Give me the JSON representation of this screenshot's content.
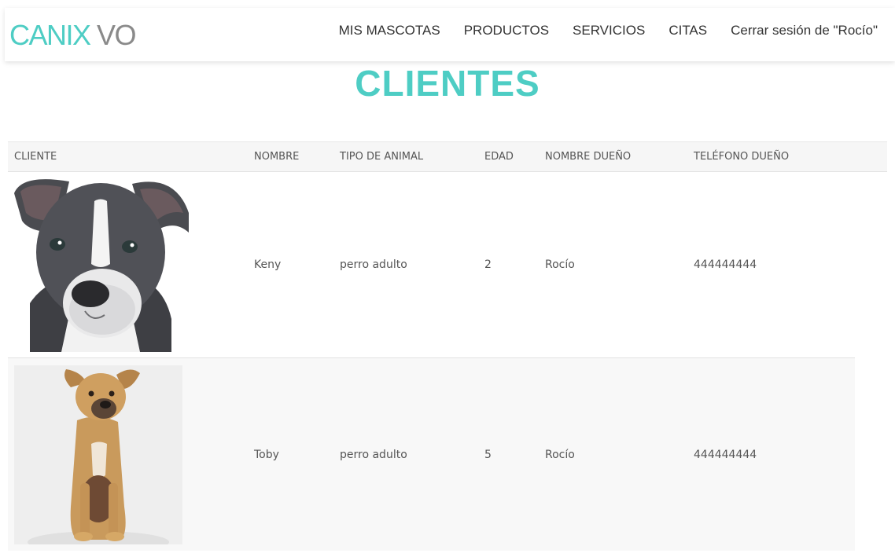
{
  "brand": {
    "part1": "CANIX",
    "part2": "VO"
  },
  "nav": {
    "items": [
      {
        "label": "MIS MASCOTAS"
      },
      {
        "label": "PRODUCTOS"
      },
      {
        "label": "SERVICIOS"
      },
      {
        "label": "CITAS"
      },
      {
        "label": "Cerrar sesión de \"Rocío\""
      }
    ]
  },
  "page_title": "CLIENTES",
  "table": {
    "headers": [
      "CLIENTE",
      "NOMBRE",
      "TIPO DE ANIMAL",
      "EDAD",
      "NOMBRE DUEÑO",
      "TELÉFONO DUEÑO"
    ],
    "rows": [
      {
        "photo": "grey-pitbull-puppy-photo",
        "nombre": "Keny",
        "tipo": "perro adulto",
        "edad": "2",
        "dueno": "Rocío",
        "telefono": "444444444"
      },
      {
        "photo": "tan-puppy-sitting-photo",
        "nombre": "Toby",
        "tipo": "perro adulto",
        "edad": "5",
        "dueno": "Rocío",
        "telefono": "444444444"
      }
    ]
  },
  "colors": {
    "accent": "#4ecdc4",
    "brand_secondary": "#8a8a8a",
    "header_bg": "#f6f6f6",
    "row_alt_bg": "#f8f8f8"
  }
}
